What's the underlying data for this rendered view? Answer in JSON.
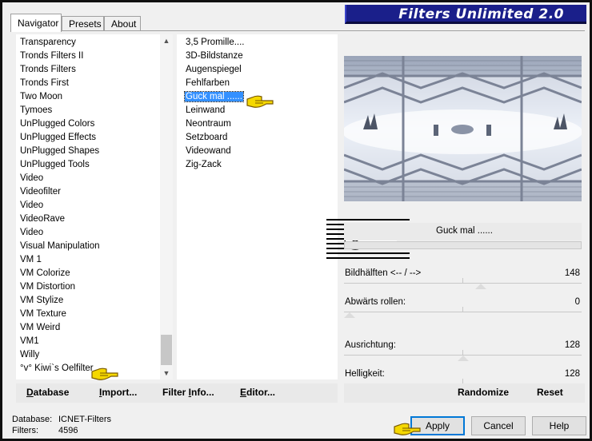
{
  "window": {
    "title": "Filters Unlimited 2.0"
  },
  "tabs": [
    {
      "label": "Navigator",
      "active": true
    },
    {
      "label": "Presets",
      "active": false
    },
    {
      "label": "About",
      "active": false
    }
  ],
  "categories": [
    "Transparency",
    "Tronds Filters II",
    "Tronds Filters",
    "Tronds First",
    "Two Moon",
    "Tymoes",
    "UnPlugged Colors",
    "UnPlugged Effects",
    "UnPlugged Shapes",
    "UnPlugged Tools",
    "Video",
    "Videofilter",
    "Video",
    "VideoRave",
    "Video",
    "Visual Manipulation",
    "VM 1",
    "VM Colorize",
    "VM Distortion",
    "VM Stylize",
    "VM Texture",
    "VM Weird",
    "VM1",
    "Willy",
    "°v° Kiwi`s Oelfilter"
  ],
  "filters": {
    "items": [
      "3,5 Promille....",
      "3D-Bildstanze",
      "Augenspiegel",
      "Fehlfarben",
      "Guck mal ......",
      "Leinwand",
      "Neontraum",
      "Setzboard",
      "Videowand",
      "Zig-Zack"
    ],
    "selected_index": 4
  },
  "left_buttons": {
    "database": {
      "pre": "",
      "ul": "D",
      "post": "atabase"
    },
    "import": {
      "pre": "",
      "ul": "I",
      "post": "mport..."
    },
    "filter_info": {
      "pre": "Filter ",
      "ul": "I",
      "post": "nfo..."
    },
    "editor": {
      "pre": "",
      "ul": "E",
      "post": "ditor..."
    }
  },
  "preview": {
    "filter_name": "Guck mal ......"
  },
  "watermark": {
    "text": "claudia"
  },
  "params": [
    {
      "label": "Bildhälften <-- / -->",
      "value": "148",
      "fraction": 0.58
    },
    {
      "label": "Abwärts rollen:",
      "value": "0",
      "fraction": 0.0
    },
    {
      "label": "Ausrichtung:",
      "value": "128",
      "fraction": 0.5
    },
    {
      "label": "Helligkeit:",
      "value": "128",
      "fraction": 0.5
    }
  ],
  "right_buttons": {
    "randomize": "Randomize",
    "reset": "Reset"
  },
  "status": {
    "database_label": "Database:",
    "database_value": "ICNET-Filters",
    "filters_label": "Filters:",
    "filters_value": "4596"
  },
  "dialog_buttons": {
    "apply": "Apply",
    "cancel": "Cancel",
    "help": "Help"
  },
  "colors": {
    "banner": "#1a1f8a",
    "selection": "#3390ff",
    "pointer_hand": "#f5d800"
  }
}
